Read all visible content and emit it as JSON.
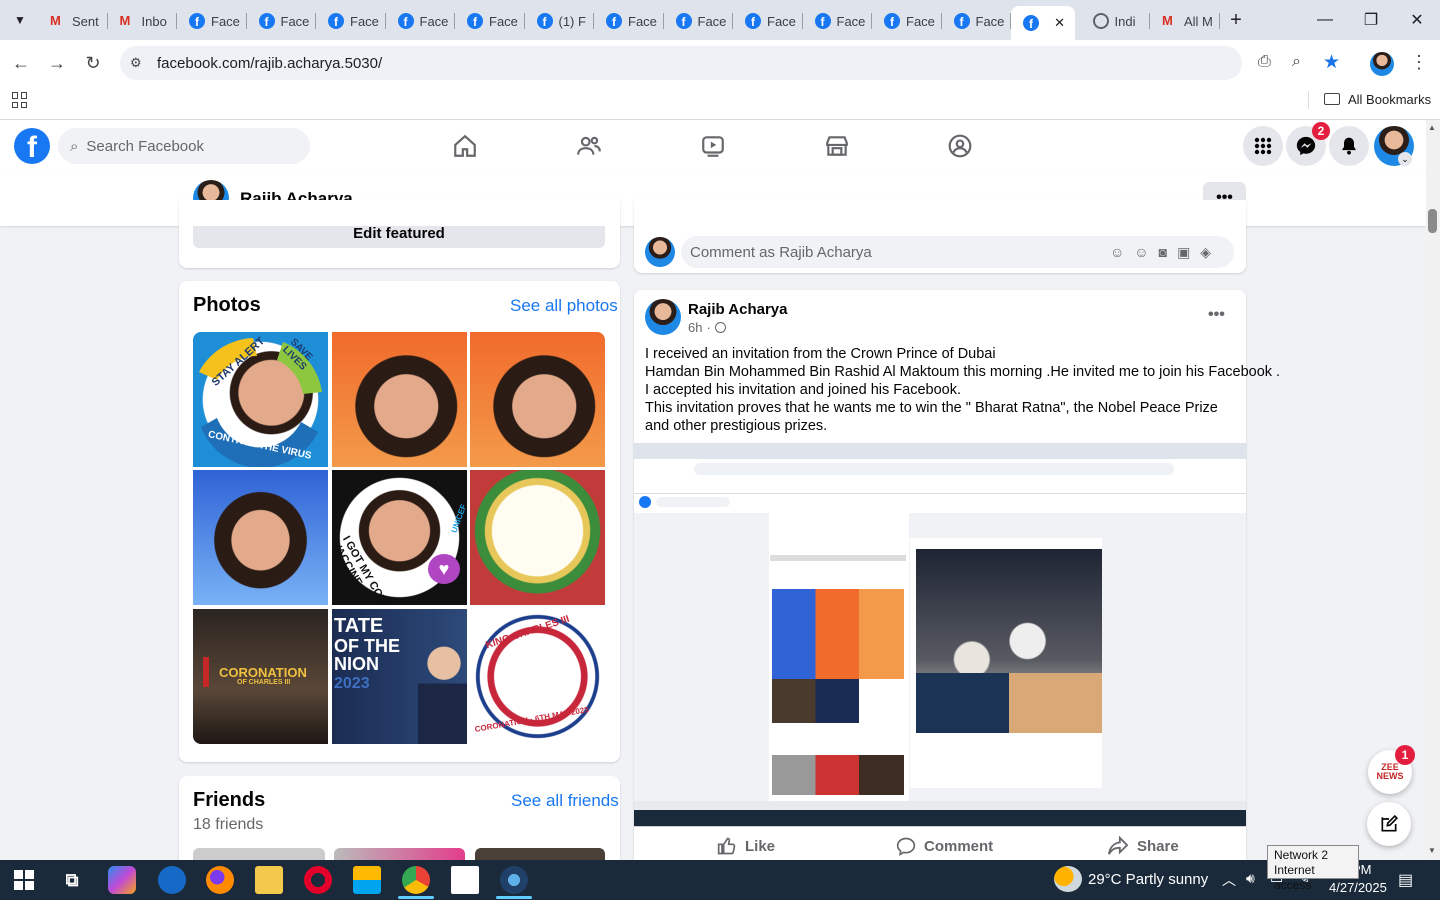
{
  "browser": {
    "tabs": [
      {
        "title": "Sent",
        "icon": "gmail-icon"
      },
      {
        "title": "Inbo",
        "icon": "gmail-icon"
      },
      {
        "title": "Face",
        "icon": "facebook-icon"
      },
      {
        "title": "Face",
        "icon": "facebook-icon"
      },
      {
        "title": "Face",
        "icon": "facebook-icon"
      },
      {
        "title": "Face",
        "icon": "facebook-icon"
      },
      {
        "title": "Face",
        "icon": "facebook-icon"
      },
      {
        "title": "(1) F",
        "icon": "facebook-icon"
      },
      {
        "title": "Face",
        "icon": "facebook-icon"
      },
      {
        "title": "Face",
        "icon": "facebook-icon"
      },
      {
        "title": "Face",
        "icon": "facebook-icon"
      },
      {
        "title": "Face",
        "icon": "facebook-icon"
      },
      {
        "title": "Face",
        "icon": "facebook-icon"
      },
      {
        "title": "Face",
        "icon": "facebook-icon"
      },
      {
        "title": "",
        "icon": "facebook-icon",
        "active": true
      },
      {
        "title": "Indi",
        "icon": "globe-icon"
      },
      {
        "title": "All M",
        "icon": "gmail-icon"
      }
    ],
    "url": "facebook.com/rajib.acharya.5030/",
    "bookmarks_label": "All Bookmarks"
  },
  "fb": {
    "search_placeholder": "Search Facebook",
    "messenger_badge": "2",
    "profile_name": "Rajib Acharya"
  },
  "left": {
    "edit_featured": "Edit featured",
    "photos_title": "Photos",
    "see_all_photos": "See all photos",
    "photo_captions": {
      "virus_top": "STAY ALERT",
      "virus_right": "SAVE LIVES",
      "virus_bottom": "CONTROL THE VIRUS",
      "vaccine": "I GOT MY COVID-19 VACCINE",
      "unicef": "UNICEF",
      "coronation": "CORONATION",
      "coronation_sub": "OF CHARLES III",
      "tate_line1": "TATE",
      "tate_line2": "OF THE",
      "tate_line3": "NION",
      "tate_year": "2023",
      "kc_top": "KING CHARLES III",
      "kc_bottom": "CORONATION · 6TH MAY 2023"
    },
    "friends_title": "Friends",
    "see_all_friends": "See all friends",
    "friends_count": "18 friends"
  },
  "post": {
    "comment_placeholder": "Comment as Rajib Acharya",
    "author": "Rajib Acharya",
    "time": "6h",
    "text_lines": [
      "I received an invitation from the Crown Prince of Dubai",
      "Hamdan Bin Mohammed Bin Rashid Al Maktoum this morning .He invited me to join his Facebook .",
      "I accepted his invitation and joined his Facebook.",
      "This invitation proves that he wants me to win the \" Bharat Ratna\", the Nobel Peace Prize and other prestigious prizes."
    ],
    "like": "Like",
    "comment": "Comment",
    "share": "Share"
  },
  "floating": {
    "news_badge": "1",
    "news_label": "ZEE NEWS"
  },
  "taskbar": {
    "weather": "29°C  Partly sunny",
    "time": "PM",
    "date": "4/27/2025",
    "tooltip_line1": "Network  2",
    "tooltip_line2": "Internet access"
  }
}
